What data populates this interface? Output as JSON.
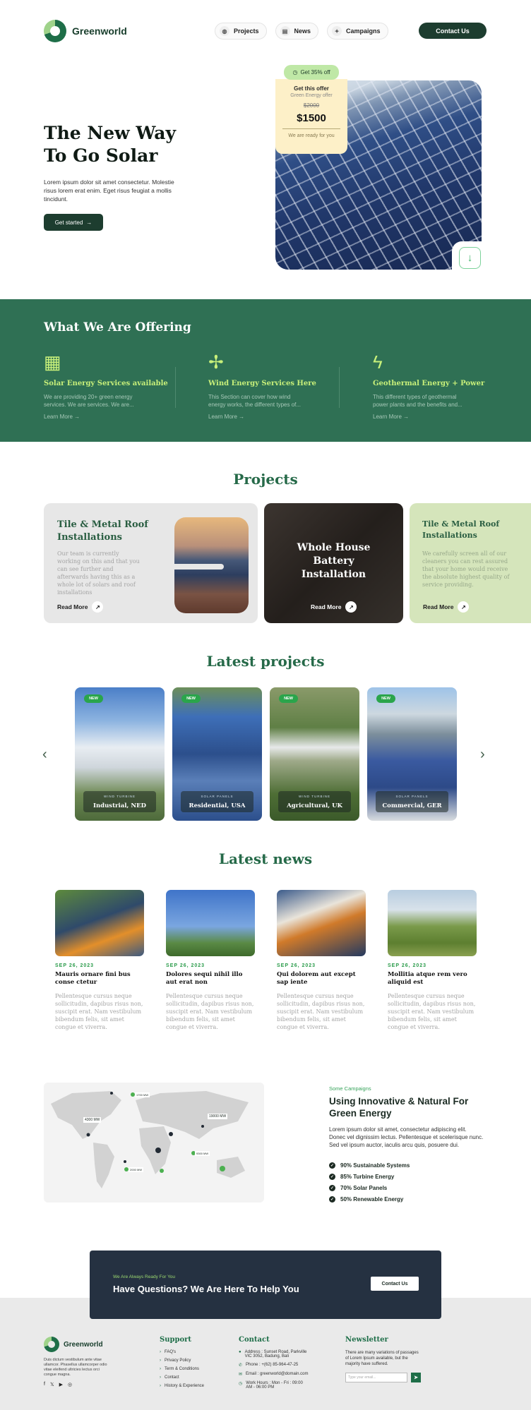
{
  "header": {
    "brand": "Greenworld",
    "nav": [
      {
        "label": "Projects",
        "icon": "globe-icon"
      },
      {
        "label": "News",
        "icon": "newspaper-icon"
      },
      {
        "label": "Campaigns",
        "icon": "megaphone-icon"
      }
    ],
    "contact_label": "Contact Us"
  },
  "hero": {
    "title": "The New  Way To Go Solar",
    "text": "Lorem ipsum dolor sit amet consectetur. Molestie risus lorem erat enim. Eget risus feugiat a mollis tincidunt.",
    "cta_label": "Get started",
    "offer": {
      "tag": "Get 35% off",
      "title": "Get this offer",
      "subtitle": "Green Energy offer",
      "old_price": "$2000",
      "price": "$1500",
      "note": "We are ready for you"
    }
  },
  "offering": {
    "title": "What We Are Offering",
    "services": [
      {
        "title": "Solar Energy Services available",
        "text": "We are providing 20+ green energy services. We are services. We are...",
        "link": "Learn More",
        "icon": "solar-panel-icon"
      },
      {
        "title": "Wind Energy Services Here",
        "text": "This Section can cover how wind energy works, the different types of...",
        "link": "Learn More",
        "icon": "wind-turbine-icon"
      },
      {
        "title": "Geothermal Energy + Power",
        "text": "This different types of geothermal power plants and the benefits and...",
        "link": "Learn More",
        "icon": "lightning-icon"
      }
    ]
  },
  "projects": {
    "title": "Projects",
    "cards": [
      {
        "title": "Tile & Metal Roof Installations",
        "text": "Our team is currently working on this and that you can see further and afterwards having this as a whole lot of solars and roof installations",
        "link": "Read More"
      },
      {
        "title": "Whole House Battery Installation",
        "link": "Read More"
      },
      {
        "title": "Tile & Metal Roof Installations",
        "text": "We carefully screen all of our cleaners you can rest assured that your home would receive the absolute highest quality of service providing.",
        "link": "Read More"
      }
    ]
  },
  "latest_projects": {
    "title": "Latest projects",
    "badge": "NEW",
    "items": [
      {
        "category": "WIND TURBINE",
        "name": "Industrial, NED"
      },
      {
        "category": "SOLAR PANELS",
        "name": "Residential, USA"
      },
      {
        "category": "WIND TURBINE",
        "name": "Agricultural, UK"
      },
      {
        "category": "SOLAR PANELS",
        "name": "Commercial, GER"
      }
    ]
  },
  "news": {
    "title": "Latest news",
    "items": [
      {
        "date": "SEP 26, 2023",
        "title": "Mauris ornare fini bus conse ctetur",
        "text": "Pellentesque cursus neque sollicitudin, dapibus risus non, suscipit erat. Nam vestibulum bibendum felis, sit amet congue et viverra."
      },
      {
        "date": "SEP 26, 2023",
        "title": "Dolores sequi nihil illo aut erat non",
        "text": "Pellentesque cursus neque sollicitudin, dapibus risus non, suscipit erat. Nam vestibulum bibendum felis, sit amet congue et viverra."
      },
      {
        "date": "SEP 26, 2023",
        "title": "Qui dolorem aut except sap iente",
        "text": "Pellentesque cursus neque sollicitudin, dapibus risus non, suscipit erat. Nam vestibulum bibendum felis, sit amet congue et viverra."
      },
      {
        "date": "SEP 26, 2023",
        "title": "Mollitia atque rem vero aliquid est",
        "text": "Pellentesque cursus neque sollicitudin, dapibus risus non, suscipit erat. Nam vestibulum bibendum felis, sit amet congue et viverra."
      }
    ]
  },
  "campaigns": {
    "map_labels": [
      "4300 MW",
      "19000 MW",
      "1700 MW",
      "9300 MW",
      "2000 MW"
    ],
    "subtitle": "Some Campaigns",
    "title": "Using Innovative & Natural For Green Energy",
    "text": "Lorem ipsum dolor sit amet, consectetur adipiscing elit. Donec vel dignissim lectus. Pellentesque et scelerisque nunc. Sed vel ipsum auctor, iaculis arcu quis, posuere dui.",
    "stats": [
      "90% Sustainable Systems",
      "85% Turbine Energy",
      "70% Solar Panels",
      "50% Renewable Energy"
    ]
  },
  "cta": {
    "subtitle": "We Are Always Ready For You",
    "title": "Have Questions? We Are Here To Help You",
    "button": "Contact Us"
  },
  "footer": {
    "brand": "Greenworld",
    "description": "Duis dictum vestibulum ante vitae ullamcor. Phasellus ullamcorper odio vitae eleifend ultricies lectus orci congue magna.",
    "support_title": "Support",
    "support_links": [
      "FAQ's",
      "Privacy Policy",
      "Term & Conditions",
      "Contact",
      "History & Experience"
    ],
    "contact_title": "Contact",
    "contact_items": [
      "Address : Sunset Road, Parkville VIC 3052, Badung, Bali",
      "Phone : +(62) 85-964-47-25",
      "Email : greenworld@domain.com",
      "Work Hours : Mon - Fri : 09:00 AM - 06:00 PM"
    ],
    "newsletter_title": "Newsletter",
    "newsletter_text": "There are many variations of passages of Lorem Ipsum available, but the majority have suffered.",
    "newsletter_placeholder": "Type your email..."
  },
  "colors": {
    "primary": "#1d3d2f",
    "accent": "#2f7054",
    "lime": "#c8f07a",
    "news_date": "#2a9b4a"
  }
}
